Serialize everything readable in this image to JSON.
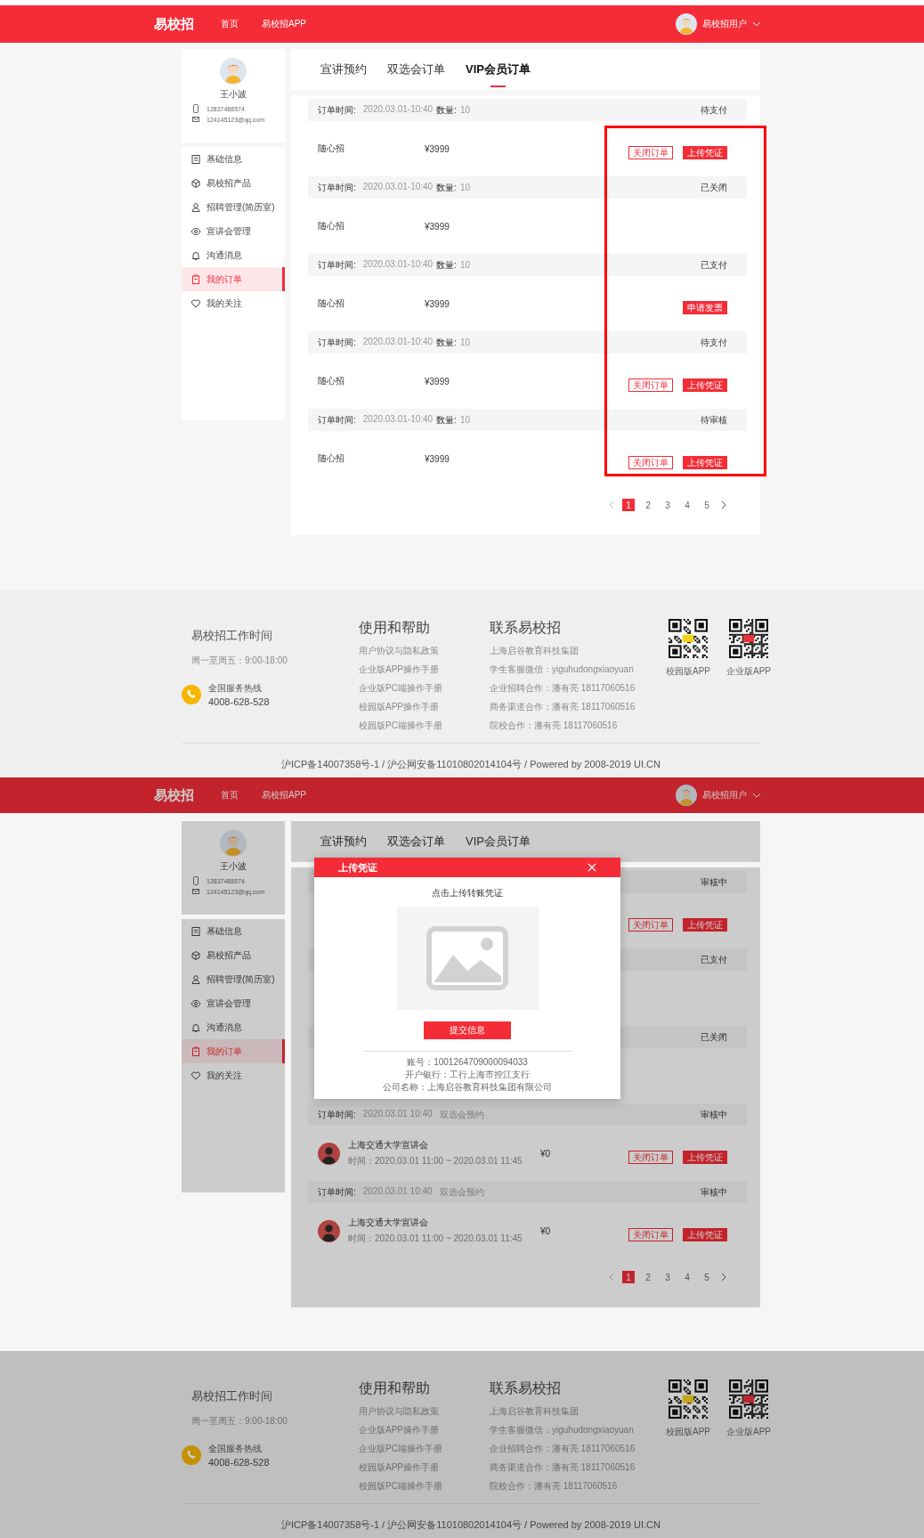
{
  "screens": [
    {
      "dimmed": false,
      "highlight": true,
      "header": {
        "logo": "易校招",
        "nav": [
          {
            "label": "首页"
          },
          {
            "label": "易校招APP"
          }
        ],
        "user": "易校招用户"
      },
      "profile": {
        "name": "王小波",
        "phone": "12837488574",
        "email": "124145123@qq.com"
      },
      "menu": [
        {
          "label": "基础信息",
          "selected": false
        },
        {
          "label": "易校招产品",
          "selected": false
        },
        {
          "label": "招聘管理(简历室)",
          "selected": false
        },
        {
          "label": "宣讲会管理",
          "selected": false
        },
        {
          "label": "沟通消息",
          "selected": false
        },
        {
          "label": "我的订单",
          "selected": true
        },
        {
          "label": "我的关注",
          "selected": false
        }
      ],
      "tabs": [
        {
          "label": "宣讲预约",
          "selected": false
        },
        {
          "label": "双选会订单",
          "selected": false
        },
        {
          "label": "VIP会员订单",
          "selected": true
        }
      ],
      "orders": [
        {
          "header": {
            "time_label": "订单时间:",
            "time": "2020.03.01-10:40",
            "qty_label": "数量:",
            "qty": "10",
            "status": "待支付"
          },
          "item": {
            "kind": "product",
            "name": "随心招",
            "price": "¥3999"
          },
          "actions": [
            {
              "label": "关闭订单",
              "kind": "outline"
            },
            {
              "label": "上传凭证",
              "kind": "filled"
            }
          ]
        },
        {
          "header": {
            "time_label": "订单时间:",
            "time": "2020.03.01-10:40",
            "qty_label": "数量:",
            "qty": "10",
            "status": "已关闭"
          },
          "item": {
            "kind": "product",
            "name": "随心招",
            "price": "¥3999"
          }
        },
        {
          "header": {
            "time_label": "订单时间:",
            "time": "2020.03.01-10:40",
            "qty_label": "数量:",
            "qty": "10",
            "status": "已支付"
          },
          "item": {
            "kind": "product",
            "name": "随心招",
            "price": "¥3999"
          },
          "actions": [
            {
              "label": "申请发票",
              "kind": "filled"
            }
          ]
        },
        {
          "header": {
            "time_label": "订单时间:",
            "time": "2020.03.01-10:40",
            "qty_label": "数量:",
            "qty": "10",
            "status": "待支付"
          },
          "item": {
            "kind": "product",
            "name": "随心招",
            "price": "¥3999"
          },
          "actions": [
            {
              "label": "关闭订单",
              "kind": "outline"
            },
            {
              "label": "上传凭证",
              "kind": "filled"
            }
          ]
        },
        {
          "header": {
            "time_label": "订单时间:",
            "time": "2020.03.01-10:40",
            "qty_label": "数量:",
            "qty": "10",
            "status": "待审核"
          },
          "item": {
            "kind": "product",
            "name": "随心招",
            "price": "¥3999"
          },
          "actions": [
            {
              "label": "关闭订单",
              "kind": "outline"
            },
            {
              "label": "上传凭证",
              "kind": "filled"
            }
          ]
        }
      ],
      "pagination": {
        "pages": [
          {
            "label": "1",
            "selected": true
          },
          {
            "label": "2",
            "selected": false
          },
          {
            "label": "3",
            "selected": false
          },
          {
            "label": "4",
            "selected": false
          },
          {
            "label": "5",
            "selected": false
          }
        ]
      },
      "footer": {
        "hours": {
          "title": "易校招工作时间",
          "hours": "周一至周五：9:00-18:00",
          "hotline_label": "全国服务热线",
          "hotline": "4008-628-528"
        },
        "help": {
          "title": "使用和帮助",
          "links": [
            "用户协议与隐私政策",
            "企业版APP操作手册",
            "企业版PC端操作手册",
            "校园版APP操作手册",
            "校园版PC端操作手册"
          ]
        },
        "contact": {
          "title": "联系易校招",
          "lines": [
            "上海启谷教育科技集团",
            "学生客服微信：yiguhudongxiaoyuan",
            "企业招聘合作：潘有亮 18117060516",
            "商务渠道合作：潘有亮 18117060516",
            "院校合作：潘有亮 18117060516"
          ]
        },
        "apps": [
          {
            "label": "校园版APP"
          },
          {
            "label": "企业版APP"
          }
        ],
        "copyright": "沪ICP备14007358号-1 / 沪公网安备11010802014104号 / Powered by 2008-2019 UI.CN"
      }
    },
    {
      "dimmed": true,
      "header": {
        "logo": "易校招",
        "nav": [
          {
            "label": "首页"
          },
          {
            "label": "易校招APP"
          }
        ],
        "user": "易校招用户"
      },
      "profile": {
        "name": "王小波",
        "phone": "12837488574",
        "email": "124145123@qq.com"
      },
      "menu": [
        {
          "label": "基础信息",
          "selected": false
        },
        {
          "label": "易校招产品",
          "selected": false
        },
        {
          "label": "招聘管理(简历室)",
          "selected": false
        },
        {
          "label": "宣讲会管理",
          "selected": false
        },
        {
          "label": "沟通消息",
          "selected": false
        },
        {
          "label": "我的订单",
          "selected": true
        },
        {
          "label": "我的关注",
          "selected": false
        }
      ],
      "tabs": [
        {
          "label": "宣讲预约",
          "selected": false
        },
        {
          "label": "双选会订单",
          "selected": false
        },
        {
          "label": "VIP会员订单",
          "selected": false
        }
      ],
      "orders": [
        {
          "header": {
            "status": "审核中"
          },
          "actions": [
            {
              "label": "关闭订单",
              "kind": "outline"
            },
            {
              "label": "上传凭证",
              "kind": "filled"
            }
          ]
        },
        {
          "header": {
            "status": "已支付"
          }
        },
        {
          "header": {
            "status": "已关闭"
          }
        },
        {
          "header": {
            "time_label": "订单时间:",
            "time": "2020.03.01 10:40",
            "type": "双选会预约",
            "status": "审核中"
          },
          "item": {
            "kind": "event",
            "title": "上海交通大学宣讲会",
            "subtitle": "时间：2020.03.01  11:00 ~ 2020.03.01  11:45",
            "price": "¥0"
          },
          "actions": [
            {
              "label": "关闭订单",
              "kind": "outline"
            },
            {
              "label": "上传凭证",
              "kind": "filled"
            }
          ]
        },
        {
          "header": {
            "time_label": "订单时间:",
            "time": "2020.03.01 10:40",
            "type": "双选会预约",
            "status": "审核中"
          },
          "item": {
            "kind": "event",
            "title": "上海交通大学宣讲会",
            "subtitle": "时间：2020.03.01  11:00 ~ 2020.03.01  11:45",
            "price": "¥0"
          },
          "actions": [
            {
              "label": "关闭订单",
              "kind": "outline"
            },
            {
              "label": "上传凭证",
              "kind": "filled"
            }
          ]
        }
      ],
      "pagination": {
        "pages": [
          {
            "label": "1",
            "selected": true
          },
          {
            "label": "2",
            "selected": false
          },
          {
            "label": "3",
            "selected": false
          },
          {
            "label": "4",
            "selected": false
          },
          {
            "label": "5",
            "selected": false
          }
        ]
      },
      "modal": {
        "title": "上传凭证",
        "prompt": "点击上传转账凭证",
        "submit": "提交信息",
        "info": [
          "账号：1001264709000094033",
          "开户银行：工行上海市控江支行",
          "公司名称：上海启谷教育科技集团有限公司"
        ]
      },
      "footer": {
        "hours": {
          "title": "易校招工作时间",
          "hours": "周一至周五：9:00-18:00",
          "hotline_label": "全国服务热线",
          "hotline": "4008-628-528"
        },
        "help": {
          "title": "使用和帮助",
          "links": [
            "用户协议与隐私政策",
            "企业版APP操作手册",
            "企业版PC端操作手册",
            "校园版APP操作手册",
            "校园版PC端操作手册"
          ]
        },
        "contact": {
          "title": "联系易校招",
          "lines": [
            "上海启谷教育科技集团",
            "学生客服微信：yiguhudongxiaoyuan",
            "企业招聘合作：潘有亮 18117060516",
            "商务渠道合作：潘有亮 18117060516",
            "院校合作：潘有亮 18117060516"
          ]
        },
        "apps": [
          {
            "label": "校园版APP"
          },
          {
            "label": "企业版APP"
          }
        ],
        "copyright": "沪ICP备14007358号-1 / 沪公网安备11010802014104号 / Powered by 2008-2019 UI.CN"
      }
    }
  ]
}
